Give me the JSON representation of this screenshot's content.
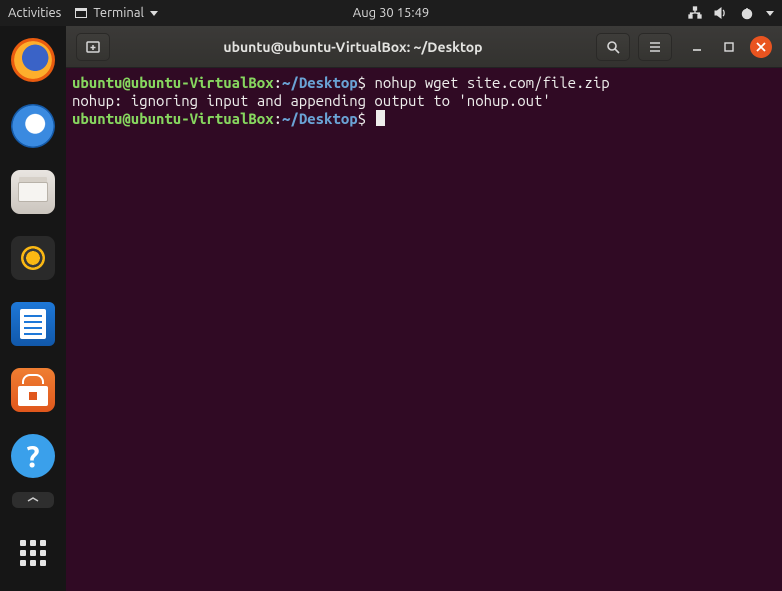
{
  "topbar": {
    "activities": "Activities",
    "app_name": "Terminal",
    "clock": "Aug 30  15:49"
  },
  "dock": {
    "items": [
      {
        "name": "firefox",
        "label": "Firefox Web Browser"
      },
      {
        "name": "thunderbird",
        "label": "Thunderbird Mail"
      },
      {
        "name": "files",
        "label": "Files"
      },
      {
        "name": "rhythmbox",
        "label": "Rhythmbox"
      },
      {
        "name": "writer",
        "label": "LibreOffice Writer"
      },
      {
        "name": "software",
        "label": "Ubuntu Software"
      },
      {
        "name": "help",
        "label": "Help"
      }
    ],
    "apps_label": "Show Applications"
  },
  "window": {
    "title": "ubuntu@ubuntu-VirtualBox: ~/Desktop"
  },
  "terminal": {
    "prompt_user": "ubuntu@ubuntu-VirtualBox",
    "prompt_sep": ":",
    "prompt_path": "~/Desktop",
    "prompt_sym": "$",
    "lines": [
      {
        "cmd": "nohup wget site.com/file.zip"
      },
      {
        "out": "nohup: ignoring input and appending output to 'nohup.out'"
      }
    ]
  }
}
